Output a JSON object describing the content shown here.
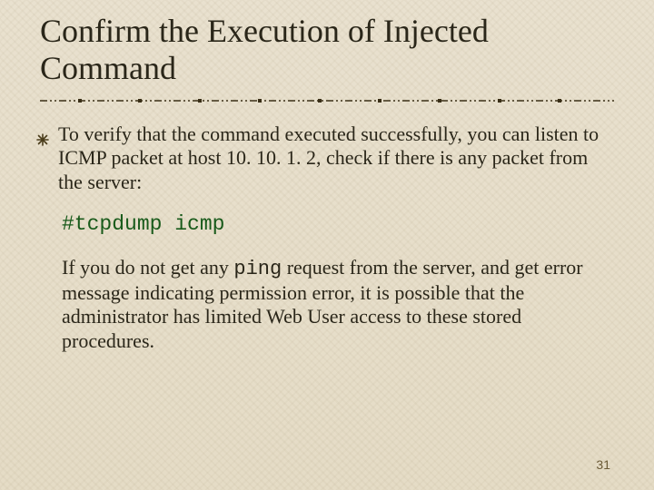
{
  "title": "Confirm the Execution of Injected Command",
  "bullet1": "To verify that the command executed successfully, you can listen to ICMP packet at host 10. 10. 1. 2, check if there is any packet from the server:",
  "command": "#tcpdump icmp",
  "para2_a": "If you do not get any ",
  "para2_ping": "ping",
  "para2_b": " request from the server, and get error message indicating permission error, it is possible that the administrator has limited Web User access to these stored procedures.",
  "slide_number": "31"
}
